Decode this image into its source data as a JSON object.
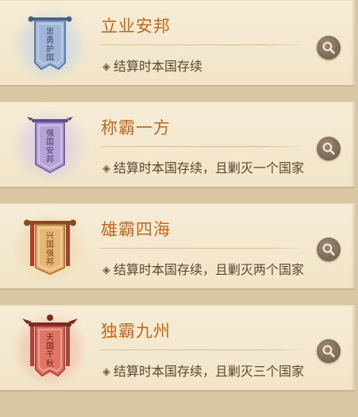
{
  "achievements": [
    {
      "title": "立业安邦",
      "desc": "结算时本国存续",
      "icon": "banner-blue-icon",
      "banner_text": [
        "忠",
        "勇",
        "护",
        "国"
      ],
      "colors": {
        "cloth": "#9fb6d8",
        "edge": "#5f7ca8",
        "halo": "#bcd3e8",
        "text": "#3c4a66"
      }
    },
    {
      "title": "称霸一方",
      "desc": "结算时本国存续，且剿灭一个国家",
      "icon": "banner-purple-icon",
      "banner_text": [
        "强",
        "国",
        "安",
        "邦"
      ],
      "colors": {
        "cloth": "#b8a3d8",
        "edge": "#7a63a8",
        "halo": "#d3c6ea",
        "text": "#4a3c66"
      }
    },
    {
      "title": "雄霸四海",
      "desc": "结算时本国存续，且剿灭两个国家",
      "icon": "banner-gold-icon",
      "banner_text": [
        "兴",
        "国",
        "强",
        "邦"
      ],
      "colors": {
        "cloth": "#e6b877",
        "edge": "#b67a3a",
        "halo": "#f0d3a3",
        "text": "#7a3e1a"
      }
    },
    {
      "title": "独霸九州",
      "desc": "结算时本国存续，且剿灭三个国家",
      "icon": "banner-red-icon",
      "banner_text": [
        "天",
        "国",
        "千",
        "秋"
      ],
      "colors": {
        "cloth": "#e07567",
        "edge": "#b2443a",
        "halo": "#f0b0a0",
        "text": "#6a1e16"
      }
    }
  ],
  "icons": {
    "desc_marker": "◈",
    "search": "magnifier-icon"
  }
}
